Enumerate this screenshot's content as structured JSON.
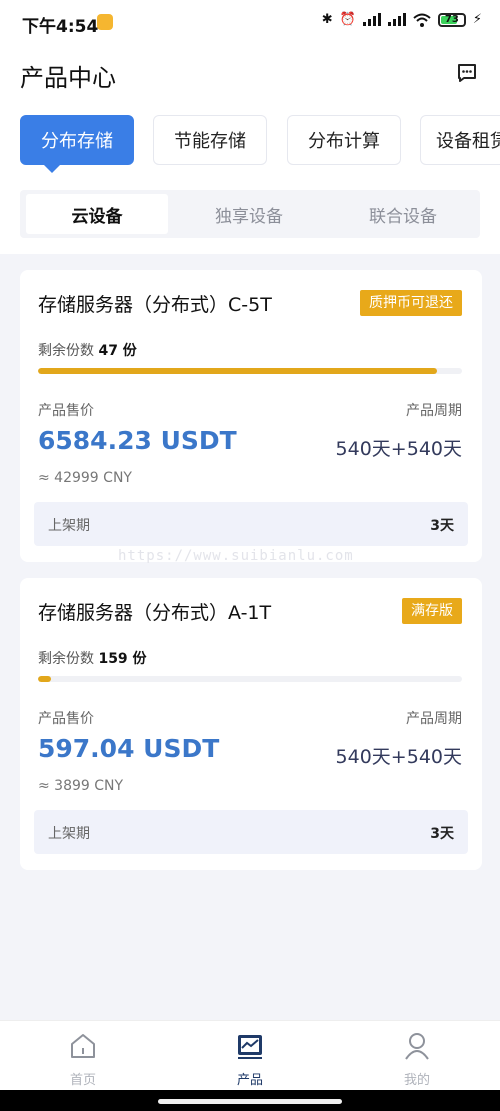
{
  "status": {
    "time": "下午4:54",
    "battery": "73",
    "battery_level": 0.73
  },
  "header": {
    "title": "产品中心"
  },
  "categories": [
    {
      "label": "分布存储",
      "active": true
    },
    {
      "label": "节能存储"
    },
    {
      "label": "分布计算"
    },
    {
      "label": "设备租赁"
    }
  ],
  "subtabs": [
    {
      "label": "云设备",
      "active": true
    },
    {
      "label": "独享设备"
    },
    {
      "label": "联合设备"
    }
  ],
  "products": [
    {
      "name": "存储服务器（分布式）C-5T",
      "badge": "质押币可退还",
      "remain_label": "剩余份数",
      "remain": "47 份",
      "progress": 0.94,
      "price_label": "产品售价",
      "price": "6584.23 USDT",
      "cny": "≈ 42999 CNY",
      "period_label": "产品周期",
      "period": "540天+540天",
      "shelf_label": "上架期",
      "shelf": "3天"
    },
    {
      "name": "存储服务器（分布式）A-1T",
      "badge": "满存版",
      "remain_label": "剩余份数",
      "remain": "159 份",
      "progress": 0.03,
      "price_label": "产品售价",
      "price": "597.04 USDT",
      "cny": "≈ 3899 CNY",
      "period_label": "产品周期",
      "period": "540天+540天",
      "shelf_label": "上架期",
      "shelf": "3天"
    }
  ],
  "watermark": "https://www.suibianlu.com",
  "nav": [
    {
      "label": "首页",
      "icon": "home-icon"
    },
    {
      "label": "产品",
      "icon": "product-chart-icon",
      "active": true
    },
    {
      "label": "我的",
      "icon": "user-icon"
    }
  ],
  "colors": {
    "accent": "#3a7ee6",
    "gold": "#e2a71b",
    "price": "#3b77c9"
  }
}
